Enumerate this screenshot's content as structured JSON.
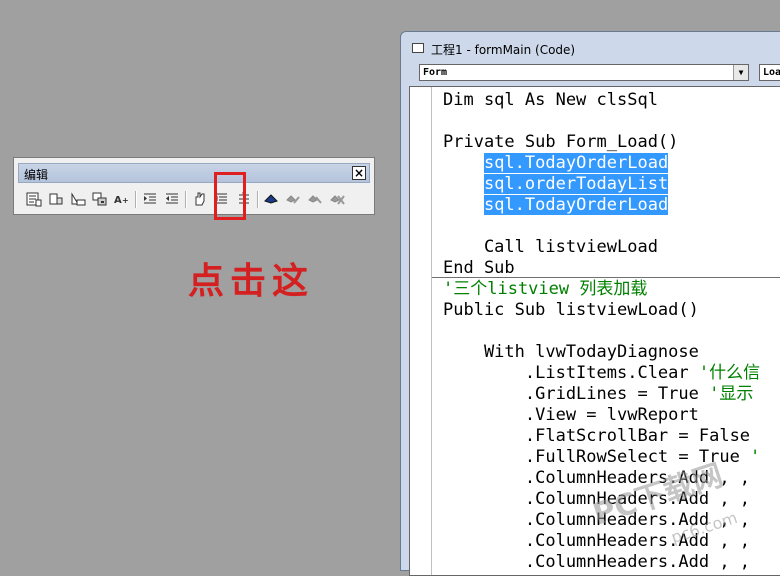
{
  "toolbar": {
    "title": "编辑",
    "close_label": "×",
    "buttons": [
      "list-properties-methods",
      "list-constants",
      "quick-info",
      "parameter-info",
      "complete-word",
      "indent",
      "outdent",
      "toggle-breakpoint",
      "comment-block",
      "uncomment-block",
      "toggle-bookmark",
      "next-bookmark",
      "previous-bookmark",
      "clear-all-bookmarks"
    ]
  },
  "annotation": "点击这",
  "code_window": {
    "title": "工程1 - formMain (Code)",
    "object_combo": "Form",
    "procedure_combo": "Load",
    "lines": [
      {
        "segments": [
          {
            "t": "Dim sql As New clsSql",
            "c": "code"
          }
        ]
      },
      {
        "segments": [
          {
            "t": "",
            "c": "code"
          }
        ]
      },
      {
        "segments": [
          {
            "t": "Private Sub Form_Load()",
            "c": "code"
          }
        ]
      },
      {
        "segments": [
          {
            "t": "    ",
            "c": "code"
          },
          {
            "t": "sql.TodayOrderLoad",
            "c": "sel"
          }
        ]
      },
      {
        "segments": [
          {
            "t": "    ",
            "c": "code"
          },
          {
            "t": "sql.orderTodayList",
            "c": "sel"
          }
        ]
      },
      {
        "segments": [
          {
            "t": "    ",
            "c": "code"
          },
          {
            "t": "sql.TodayOrderLoad",
            "c": "sel"
          }
        ]
      },
      {
        "segments": [
          {
            "t": "",
            "c": "code"
          }
        ]
      },
      {
        "segments": [
          {
            "t": "    Call listviewLoad",
            "c": "code"
          }
        ]
      },
      {
        "segments": [
          {
            "t": "End Sub",
            "c": "code"
          }
        ]
      },
      {
        "segments": [
          {
            "t": "'三个listview 列表加载",
            "c": "cm"
          }
        ]
      },
      {
        "segments": [
          {
            "t": "Public Sub listviewLoad()",
            "c": "code"
          }
        ]
      },
      {
        "segments": [
          {
            "t": "",
            "c": "code"
          }
        ]
      },
      {
        "segments": [
          {
            "t": "    With lvwTodayDiagnose",
            "c": "code"
          }
        ]
      },
      {
        "segments": [
          {
            "t": "        .ListItems.Clear ",
            "c": "code"
          },
          {
            "t": "'什么信",
            "c": "cm"
          }
        ]
      },
      {
        "segments": [
          {
            "t": "        .GridLines = True ",
            "c": "code"
          },
          {
            "t": "'显示",
            "c": "cm"
          }
        ]
      },
      {
        "segments": [
          {
            "t": "        .View = lvwReport",
            "c": "code"
          }
        ]
      },
      {
        "segments": [
          {
            "t": "        .FlatScrollBar = False",
            "c": "code"
          }
        ]
      },
      {
        "segments": [
          {
            "t": "        .FullRowSelect = True ",
            "c": "code"
          },
          {
            "t": "'",
            "c": "cm"
          }
        ]
      },
      {
        "segments": [
          {
            "t": "        .ColumnHeaders.Add , ,",
            "c": "code"
          }
        ]
      },
      {
        "segments": [
          {
            "t": "        .ColumnHeaders.Add , ,",
            "c": "code"
          }
        ]
      },
      {
        "segments": [
          {
            "t": "        .ColumnHeaders.Add , ,",
            "c": "code"
          }
        ]
      },
      {
        "segments": [
          {
            "t": "        .ColumnHeaders.Add , ,",
            "c": "code"
          }
        ]
      },
      {
        "segments": [
          {
            "t": "        .ColumnHeaders.Add , ,",
            "c": "code"
          }
        ]
      }
    ]
  },
  "watermark": {
    "main": "PC下载网",
    "sub": "pc6.com"
  },
  "colors": {
    "selection": "#3399ff",
    "comment": "#008000",
    "annotation": "#d42020",
    "highlight_box": "#e02020"
  }
}
